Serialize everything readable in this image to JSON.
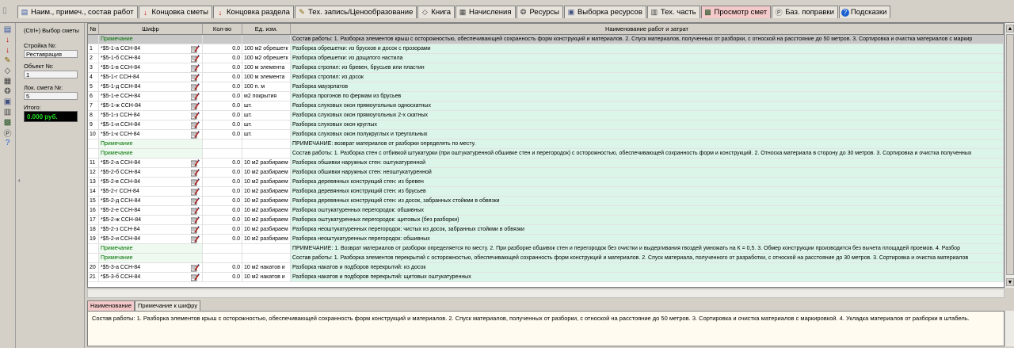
{
  "tabs": [
    {
      "label": "Наим., примеч., состав работ",
      "icon": "document-icon",
      "glyph": "▤",
      "color": "#3050a0",
      "active": false
    },
    {
      "label": "Концовка сметы",
      "icon": "arrow-down-icon",
      "glyph": "↓",
      "color": "#c00000",
      "active": false
    },
    {
      "label": "Концовка раздела",
      "icon": "arrow-down-p-icon",
      "glyph": "↓",
      "color": "#c00000",
      "active": false
    },
    {
      "label": "Тех. запись/Ценообразование",
      "icon": "pricing-icon",
      "glyph": "✎",
      "color": "#806000",
      "active": false
    },
    {
      "label": "Книга",
      "icon": "book-icon",
      "glyph": "◇",
      "color": "#404040",
      "active": false
    },
    {
      "label": "Начисления",
      "icon": "calculator-icon",
      "glyph": "▦",
      "color": "#404040",
      "active": false
    },
    {
      "label": "Ресурсы",
      "icon": "resources-icon",
      "glyph": "❂",
      "color": "#404040",
      "active": false
    },
    {
      "label": "Выборка ресурсов",
      "icon": "resource-sample-icon",
      "glyph": "▣",
      "color": "#405080",
      "active": false
    },
    {
      "label": "Тех. часть",
      "icon": "tech-part-icon",
      "glyph": "▥",
      "color": "#404040",
      "active": false
    },
    {
      "label": "Просмотр смет",
      "icon": "estimate-view-icon",
      "glyph": "▩",
      "color": "#205020",
      "active": true
    },
    {
      "label": "Баз. поправки",
      "icon": "base-corrections-icon",
      "glyph": "Ⓟ",
      "color": "#404040",
      "active": false
    },
    {
      "label": "Подсказки",
      "icon": "help-icon",
      "glyph": "?",
      "color": "#ffffff",
      "active": false
    }
  ],
  "left_toolbar": [
    {
      "icon": "document-icon",
      "glyph": "▤",
      "color": "#3050a0"
    },
    {
      "icon": "arrow-down-icon",
      "glyph": "↓",
      "color": "#c00000"
    },
    {
      "icon": "arrow-down-p-icon",
      "glyph": "↓",
      "color": "#c00000"
    },
    {
      "icon": "pricing-icon",
      "glyph": "✎",
      "color": "#806000"
    },
    {
      "icon": "book-icon",
      "glyph": "◇",
      "color": "#404040"
    },
    {
      "icon": "calculator-icon",
      "glyph": "▦",
      "color": "#404040"
    },
    {
      "icon": "resources-icon",
      "glyph": "❂",
      "color": "#404040"
    },
    {
      "icon": "resource-sample-icon",
      "glyph": "▣",
      "color": "#405080"
    },
    {
      "icon": "tech-part-icon",
      "glyph": "▥",
      "color": "#404040"
    },
    {
      "icon": "estimate-view-icon",
      "glyph": "▩",
      "color": "#205020"
    },
    {
      "icon": "base-corrections-icon",
      "glyph": "Ⓟ",
      "color": "#404040"
    },
    {
      "icon": "help-icon",
      "glyph": "?",
      "color": "#1a5fd0"
    }
  ],
  "side": {
    "select_button": "(Ctrl+) Выбор сметы",
    "stroyka_label": "Стройка №:",
    "stroyka_value": "Реставрация",
    "object_label": "Объект №:",
    "object_value": "1",
    "lok_label": "Лок. смета №:",
    "lok_value": "5",
    "total_label": "Итого:",
    "total_value": "0.000 руб."
  },
  "grid": {
    "headers": [
      "№",
      "Шифр",
      "Кол-во",
      "Ед. изм.",
      "Наименование работ и затрат"
    ],
    "rows": [
      {
        "n": "",
        "code": "Примечание",
        "qty": "",
        "unit": "",
        "name": "Состав работы: 1. Разборка элементов крыш с осторожностью, обеспечивающей сохранность форм конструкций и материалов. 2. Спуск материалов, полученных от разборки, с отноской на расстояние до 50 метров. 3. Сортировка и очистка материалов с маркир",
        "note": true,
        "first": true
      },
      {
        "n": "1",
        "code": "*$5-1-а ССН-84",
        "qty": "0.0",
        "unit": "100 м2 обрешетк",
        "name": "Разборка обрешетки: из брусков и досок с прозорами",
        "note": false
      },
      {
        "n": "2",
        "code": "*$5-1-б ССН-84",
        "qty": "0.0",
        "unit": "100 м2 обрешетк",
        "name": "Разборка обрешетки: из дощатого настила",
        "note": false
      },
      {
        "n": "3",
        "code": "*$5-1-в ССН-84",
        "qty": "0.0",
        "unit": "100 м элемента",
        "name": "Разборка стропил: из бревен, брусьев или пластин",
        "note": false
      },
      {
        "n": "4",
        "code": "*$5-1-г ССН-84",
        "qty": "0.0",
        "unit": "100 м элемента",
        "name": "Разборка стропил: из досок",
        "note": false
      },
      {
        "n": "5",
        "code": "*$5-1-д ССН-84",
        "qty": "0.0",
        "unit": "100 п. м",
        "name": "Разборка мауэрлатов",
        "note": false
      },
      {
        "n": "6",
        "code": "*$5-1-е ССН-84",
        "qty": "0.0",
        "unit": "м2 покрытия",
        "name": "Разборка прогонов по фермам из брусьев",
        "note": false
      },
      {
        "n": "7",
        "code": "*$5-1-ж ССН-84",
        "qty": "0.0",
        "unit": "шт.",
        "name": "Разборка слуховых окон прямоугольных односкатных",
        "note": false
      },
      {
        "n": "8",
        "code": "*$5-1-з ССН-84",
        "qty": "0.0",
        "unit": "шт.",
        "name": "Разборка слуховых окон прямоугольных 2-х скатных",
        "note": false
      },
      {
        "n": "9",
        "code": "*$5-1-и ССН-84",
        "qty": "0.0",
        "unit": "шт.",
        "name": "Разборка слуховых окон круглых",
        "note": false
      },
      {
        "n": "10",
        "code": "*$5-1-к ССН-84",
        "qty": "0.0",
        "unit": "шт.",
        "name": "Разборка слуховых окон полукруглых и треугольных",
        "note": false
      },
      {
        "n": "",
        "code": "Примечание",
        "qty": "",
        "unit": "",
        "name": "ПРИМЕЧАНИЕ: возврат материалов от разборки определять по месту.",
        "note": true
      },
      {
        "n": "",
        "code": "Примечание",
        "qty": "",
        "unit": "",
        "name": "Состав работы: 1. Разборка стен с отбивкой штукатурки (при оштукатуренной обшивке стен и перегородок) с осторожностью, обеспечивающей сохранность форм и конструкций. 2. Относка материала в сторону до 30 метров. 3. Сортировка и очистка полученных",
        "note": true
      },
      {
        "n": "11",
        "code": "*$5-2-а ССН-84",
        "qty": "0.0",
        "unit": "10 м2 разбираем",
        "name": "Разборка обшивки наружных стен: оштукатуренной",
        "note": false
      },
      {
        "n": "12",
        "code": "*$5-2-б ССН-84",
        "qty": "0.0",
        "unit": "10 м2 разбираем",
        "name": "Разборка обшивки наружных стен: неоштукатуренной",
        "note": false
      },
      {
        "n": "13",
        "code": "*$5-2-в ССН-84",
        "qty": "0.0",
        "unit": "10 м2 разбираем",
        "name": "Разборка деревянных конструкций стен: из бревен",
        "note": false
      },
      {
        "n": "14",
        "code": "*$5-2-г ССН-84",
        "qty": "0.0",
        "unit": "10 м2 разбираем",
        "name": "Разборка деревянных конструкций стен: из брусьев",
        "note": false
      },
      {
        "n": "15",
        "code": "*$5-2-д ССН-84",
        "qty": "0.0",
        "unit": "10 м2 разбираем",
        "name": "Разборка деревянных конструкций стен: из досок, забранных стойкми в обвязки",
        "note": false
      },
      {
        "n": "16",
        "code": "*$5-2-е ССН-84",
        "qty": "0.0",
        "unit": "10 м2 разбираем",
        "name": "Разборка оштукатуренных перегородок: обшивных",
        "note": false
      },
      {
        "n": "17",
        "code": "*$5-2-ж ССН-84",
        "qty": "0.0",
        "unit": "10 м2 разбираем",
        "name": "Разборка оштукатуренных перегородок: щитовых (без разборки)",
        "note": false
      },
      {
        "n": "18",
        "code": "*$5-2-з ССН-84",
        "qty": "0.0",
        "unit": "10 м2 разбираем",
        "name": "Разборка неоштукатуренных перегородок: чистых из досок, забранных стойкми в обвязки",
        "note": false
      },
      {
        "n": "19",
        "code": "*$5-2-и ССН-84",
        "qty": "0.0",
        "unit": "10 м2 разбираем",
        "name": "Разборка неоштукатуренных перегородок: обшивных",
        "note": false
      },
      {
        "n": "",
        "code": "Примечание",
        "qty": "",
        "unit": "",
        "name": "ПРИМЕЧАНИЕ: 1. Возврат материалов от разборки определяется по месту. 2. При разборке обшивок стен и перегородок без очистки и выдергивания гвоздей умножать на К = 0,5. 3. Обмер конструкции производится без вычета площадей проемов. 4. Разбор",
        "note": true
      },
      {
        "n": "",
        "code": "Примечание",
        "qty": "",
        "unit": "",
        "name": "Состав работы: 1. Разборка элементов перекрытий с осторожностью, обеспечивающей сохранность форм конструкций и материалов. 2. Спуск материала, полученного от разработки, с отноской на расстояние до 30 метров. 3. Сортировка и очистка материалов",
        "note": true
      },
      {
        "n": "20",
        "code": "*$5-3-а ССН-84",
        "qty": "0.0",
        "unit": "10 м2 накатов и",
        "name": "Разборка накатов и подборов перекрытий: из досок",
        "note": false
      },
      {
        "n": "21",
        "code": "*$5-3-б ССН-84",
        "qty": "0.0",
        "unit": "10 м2 накатов и",
        "name": "Разборка накатов и подборов перекрытий: щитовых оштукатуренных",
        "note": false
      }
    ]
  },
  "bottom_tabs": [
    {
      "label": "Наименование",
      "active": true
    },
    {
      "label": "Примечание к шифру",
      "active": false
    }
  ],
  "memo_text": "Состав работы: 1. Разборка элементов крыш с осторожностью, обеспечивающей сохранность форм конструкций и материалов. 2. Спуск материалов, полученных от разборки, с отноской на расстояние до 50 метров. 3. Сортировка и очистка материалов с маркировкой. 4. Укладка материалов от разборки в штабель."
}
